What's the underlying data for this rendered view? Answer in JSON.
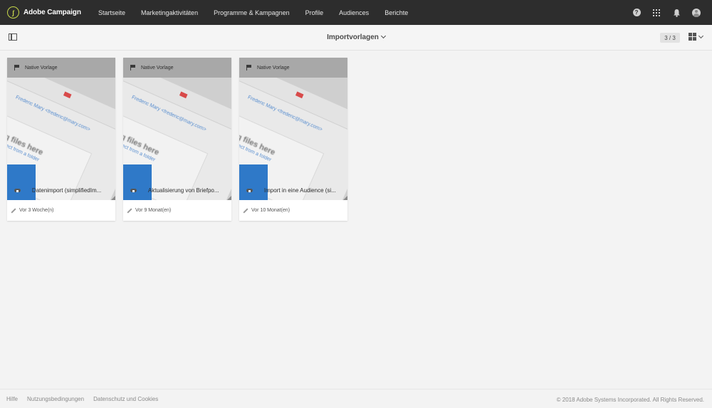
{
  "app": {
    "name": "Adobe Campaign",
    "logo_glyph": "ʃ"
  },
  "nav": {
    "links": [
      "Startseite",
      "Marketingaktivitäten",
      "Programme & Kampagnen",
      "Profile",
      "Audiences",
      "Berichte"
    ],
    "icons": [
      "help-icon",
      "apps-grid-icon",
      "bell-icon",
      "avatar-icon"
    ]
  },
  "toolbar": {
    "title": "Importvorlagen",
    "page_count": "3 / 3",
    "panel_icon": "panel-toggle-icon",
    "view_icon": "grid-view-icon"
  },
  "cards": [
    {
      "type": "Native Vorlage",
      "title": "Datenimport (simplifiedIm...",
      "modified": "Vor 3 Woche(n)"
    },
    {
      "type": "Native Vorlage",
      "title": "Aktualisierung von Briefpo...",
      "modified": "Vor 9 Monat(en)"
    },
    {
      "type": "Native Vorlage",
      "title": "Import in eine Audience (si...",
      "modified": "Vor 10 Monat(en)"
    }
  ],
  "thumbnail": {
    "sender": "Frederic Mary <frederic@mary.com>",
    "drag_text": "Drag files here",
    "select_text": "or select from a folder"
  },
  "footer": {
    "links": [
      "Hilfe",
      "Nutzungsbedingungen",
      "Datenschutz und Cookies"
    ],
    "copyright": "© 2018 Adobe Systems Incorporated. All Rights Reserved."
  },
  "colors": {
    "nav_bg": "#2d2d2d",
    "logo_accent": "#c8d84a",
    "card_header": "#a8a8a8",
    "thumbnail_blue": "#2f79c8"
  }
}
